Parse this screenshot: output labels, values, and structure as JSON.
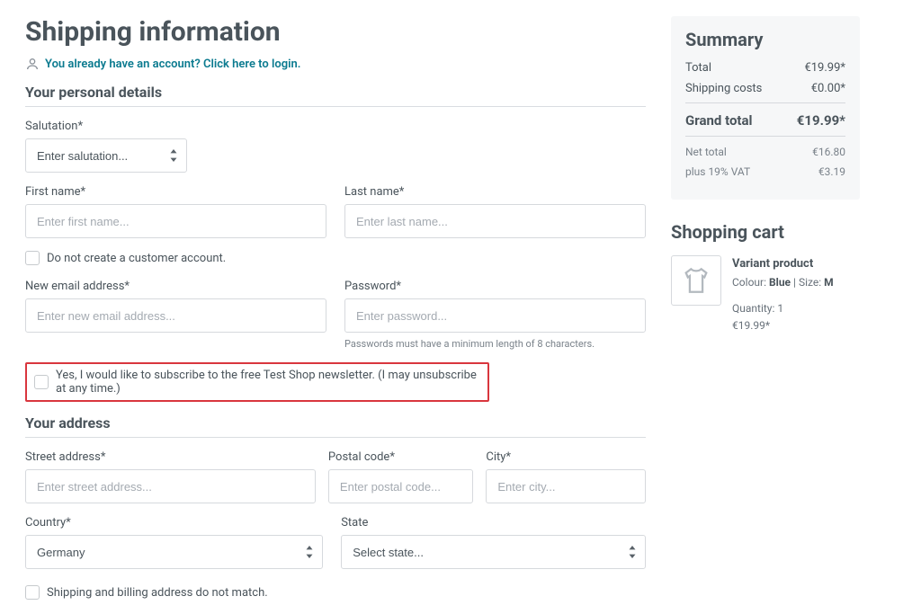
{
  "page_title": "Shipping information",
  "login_prompt": "You already have an account? Click here to login.",
  "sections": {
    "personal": "Your personal details",
    "address": "Your address"
  },
  "labels": {
    "salutation": "Salutation*",
    "first_name": "First name*",
    "last_name": "Last name*",
    "no_account": "Do not create a customer account.",
    "new_email": "New email address*",
    "password": "Password*",
    "password_hint": "Passwords must have a minimum length of 8 characters.",
    "newsletter": "Yes, I would like to subscribe to the free Test Shop newsletter. (I may unsubscribe at any time.)",
    "street": "Street address*",
    "postal": "Postal code*",
    "city": "City*",
    "country": "Country*",
    "state": "State",
    "addr_mismatch": "Shipping and billing address do not match."
  },
  "placeholders": {
    "salutation": "Enter salutation...",
    "first_name": "Enter first name...",
    "last_name": "Enter last name...",
    "new_email": "Enter new email address...",
    "password": "Enter password...",
    "street": "Enter street address...",
    "postal": "Enter postal code...",
    "city": "Enter city...",
    "state": "Select state..."
  },
  "values": {
    "country": "Germany"
  },
  "summary": {
    "title": "Summary",
    "total_label": "Total",
    "total_value": "€19.99*",
    "shipping_label": "Shipping costs",
    "shipping_value": "€0.00*",
    "grand_label": "Grand total",
    "grand_value": "€19.99*",
    "net_label": "Net total",
    "net_value": "€16.80",
    "vat_label": "plus 19% VAT",
    "vat_value": "€3.19"
  },
  "cart": {
    "title": "Shopping cart",
    "item": {
      "name": "Variant product",
      "colour_label": "Colour:",
      "colour_value": "Blue",
      "size_label": "Size:",
      "size_value": "M",
      "qty_label": "Quantity:",
      "qty_value": "1",
      "price": "€19.99*"
    }
  }
}
